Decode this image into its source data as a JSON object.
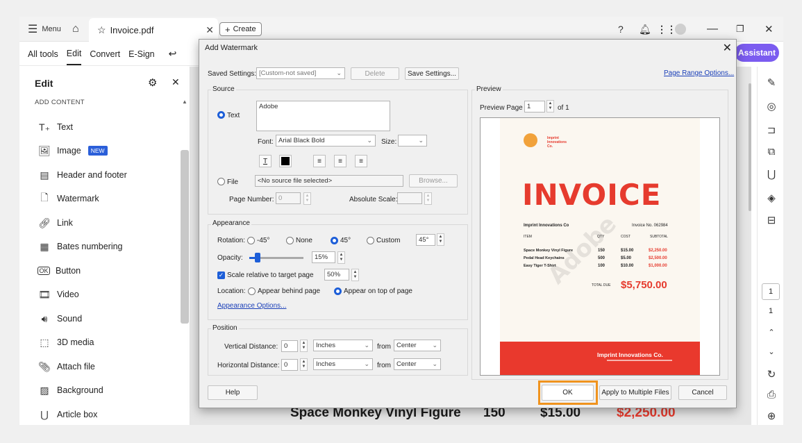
{
  "titlebar": {
    "menu": "Menu",
    "tab_title": "Invoice.pdf",
    "create": "Create"
  },
  "toolbar": {
    "items": [
      "All tools",
      "Edit",
      "Convert",
      "E-Sign"
    ]
  },
  "assistant": "Assistant",
  "sidepanel": {
    "title": "Edit",
    "section": "ADD CONTENT",
    "new_badge": "NEW",
    "items": [
      "Text",
      "Image",
      "Header and footer",
      "Watermark",
      "Link",
      "Bates numbering",
      "Button",
      "Video",
      "Sound",
      "3D media",
      "Attach file",
      "Background",
      "Article box"
    ]
  },
  "document_row": {
    "item": "Space Monkey Vinyl Figure",
    "qty": "150",
    "cost": "$15.00",
    "subtotal": "$2,250.00"
  },
  "rightrail": {
    "page_num": "1",
    "page_total": "1"
  },
  "dialog": {
    "title": "Add Watermark",
    "saved_settings_label": "Saved Settings:",
    "saved_settings_value": "[Custom-not saved]",
    "delete": "Delete",
    "save_settings": "Save Settings...",
    "page_range": "Page Range Options...",
    "source": {
      "label": "Source",
      "text_option": "Text",
      "text_value": "Adobe",
      "font_label": "Font:",
      "font_value": "Arial Black Bold",
      "size_label": "Size:",
      "file_option": "File",
      "file_value": "<No source file selected>",
      "browse": "Browse...",
      "page_number_label": "Page Number:",
      "page_number_value": "0",
      "absolute_scale_label": "Absolute Scale:"
    },
    "appearance": {
      "label": "Appearance",
      "rotation_label": "Rotation:",
      "rot_neg45": "-45°",
      "rot_none": "None",
      "rot_45": "45°",
      "rot_custom": "Custom",
      "custom_value": "45°",
      "opacity_label": "Opacity:",
      "opacity_value": "15%",
      "opacity_fraction": 0.15,
      "scale_label": "Scale relative to target page",
      "scale_value": "50%",
      "location_label": "Location:",
      "behind": "Appear behind page",
      "on_top": "Appear on top of page",
      "options_link": "Appearance Options..."
    },
    "position": {
      "label": "Position",
      "vertical_label": "Vertical Distance:",
      "vertical_value": "0",
      "horizontal_label": "Horizontal Distance:",
      "horizontal_value": "0",
      "unit": "Inches",
      "from_label": "from",
      "from_value": "Center"
    },
    "preview": {
      "label": "Preview",
      "page_label": "Preview Page",
      "page_value": "1",
      "of_label": "of 1"
    },
    "invoice": {
      "brand_line1": "Imprint",
      "brand_line2": "Innovations",
      "brand_line3": "Co.",
      "heading": "INVOICE",
      "company": "Imprint Innovations Co",
      "invoice_no": "Invoice No. 062984",
      "col_item": "ITEM",
      "col_qty": "QTY",
      "col_cost": "COST",
      "col_subtotal": "SUBTOTAL",
      "rows": [
        {
          "item": "Space Monkey Vinyl Figure",
          "qty": "150",
          "cost": "$15.00",
          "subtotal": "$2,250.00"
        },
        {
          "item": "Pedal Head Keychains",
          "qty": "500",
          "cost": "$5.00",
          "subtotal": "$2,500.00"
        },
        {
          "item": "Easy Tiger T-Shirt",
          "qty": "100",
          "cost": "$10.00",
          "subtotal": "$1,000.00"
        }
      ],
      "total_label": "TOTAL DUE",
      "total_value": "$5,750.00",
      "footer_name": "Imprint Innovations Co.",
      "watermark": "Adobe"
    },
    "buttons": {
      "help": "Help",
      "ok": "OK",
      "apply_multiple": "Apply to Multiple Files",
      "cancel": "Cancel"
    }
  }
}
